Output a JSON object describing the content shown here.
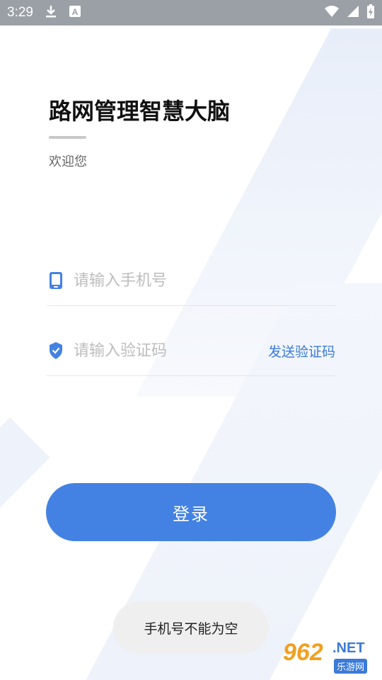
{
  "status_bar": {
    "time": "3:29"
  },
  "app": {
    "title": "路网管理智慧大脑",
    "subtitle": "欢迎您"
  },
  "phone_field": {
    "placeholder": "请输入手机号",
    "value": ""
  },
  "code_field": {
    "placeholder": "请输入验证码",
    "value": "",
    "send_code_label": "发送验证码"
  },
  "login_button": {
    "label": "登录"
  },
  "toast": {
    "message": "手机号不能为空"
  },
  "watermark": {
    "number": "962",
    "net": ".NET",
    "sub": "乐游网"
  },
  "colors": {
    "accent": "#4382e2",
    "link": "#3b7ad9",
    "status_bar": "#9aa0a6"
  },
  "icons": {
    "phone_field": "phone-icon",
    "code_field": "shield-check-icon",
    "status": [
      "download-icon",
      "font-a-icon",
      "wifi-icon",
      "signal-icon",
      "battery-charging-icon"
    ]
  }
}
